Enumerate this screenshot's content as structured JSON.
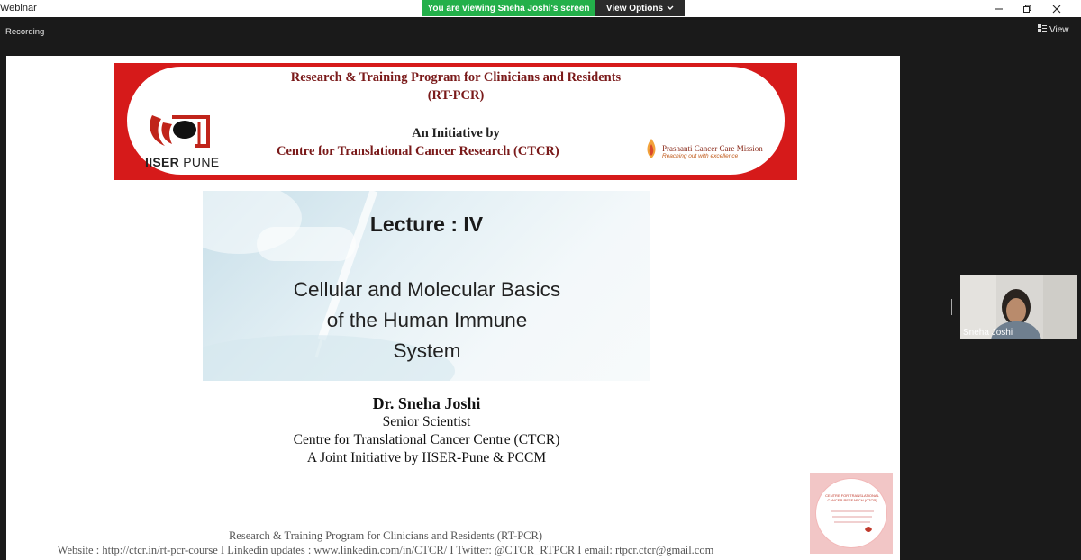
{
  "window": {
    "app_title": "Webinar",
    "share_message": "You are viewing Sneha Joshi's screen",
    "view_options_label": "View Options",
    "recording_label": "Recording",
    "view_label": "View",
    "icons": [
      "minimize-icon",
      "maximize-icon",
      "close-icon",
      "view-grid-icon",
      "chevron-down-icon"
    ]
  },
  "slide": {
    "header": {
      "program_title": "Research & Training Program  for Clinicians and Residents",
      "program_abbr": "(RT-PCR)",
      "initiative_label": "An Initiative by",
      "centre_name": "Centre for Translational  Cancer Research (CTCR)",
      "iiser_logo_text_bold": "IISER",
      "iiser_logo_text": " PUNE",
      "pccm_name": "Prashanti Cancer Care Mission",
      "pccm_tagline": "Reaching out with excellence"
    },
    "lecture": {
      "title": "Lecture : IV",
      "topic_line1": "Cellular and Molecular Basics",
      "topic_line2": "of the Human Immune",
      "topic_line3": "System"
    },
    "speaker": {
      "name": "Dr. Sneha Joshi",
      "role": "Senior Scientist",
      "organization": "Centre for Translational Cancer Centre (CTCR)",
      "joint_initiative": "A Joint Initiative by IISER-Pune & PCCM"
    },
    "footer": {
      "program_line": "Research & Training Program  for Clinicians and Residents (RT-PCR)",
      "contact_line": "Website : http://ctcr.in/rt-pcr-course   I  Linkedin updates : www.linkedin.com/in/CTCR/  I  Twitter: @CTCR_RTPCR  I  email:  rtpcr.ctcr@gmail.com"
    },
    "stamp": {
      "text": "CENTRE FOR TRANSLATIONAL CANCER RESEARCH (CTCR)"
    }
  },
  "participant": {
    "name": "Sneha Joshi"
  },
  "colors": {
    "banner_red": "#d61a1a",
    "title_maroon": "#7a1a1a",
    "share_green": "#23b04a"
  }
}
